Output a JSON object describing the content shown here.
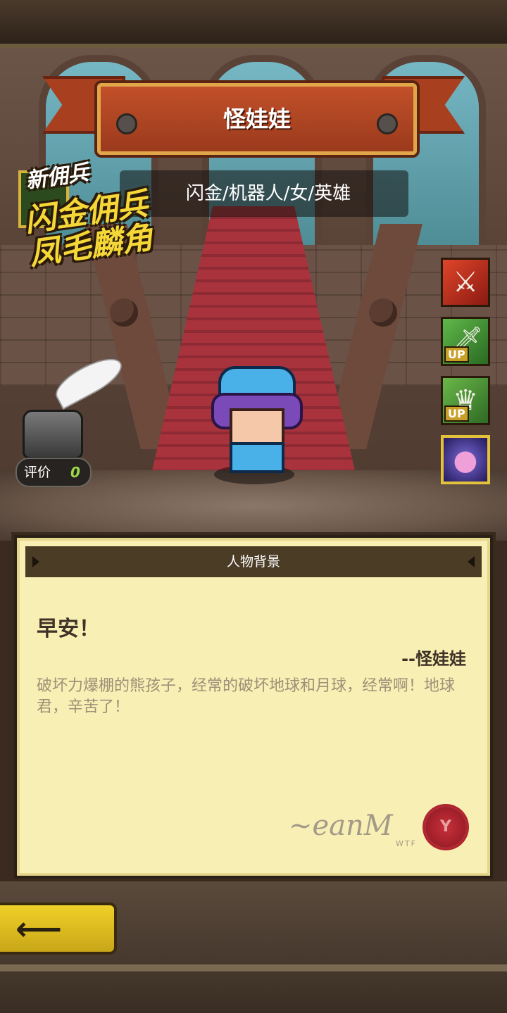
{
  "character": {
    "name": "怪娃娃",
    "subtitle": "闪金/机器人/女/英雄"
  },
  "promo": {
    "tag": "新佣兵",
    "line1": "闪金佣兵",
    "line2": "凤毛麟角"
  },
  "rating": {
    "label": "评价",
    "value": "0"
  },
  "skills": [
    {
      "icon": "slash-skill-icon"
    },
    {
      "icon": "weapon-up-icon",
      "badge": "UP"
    },
    {
      "icon": "crown-up-icon",
      "badge": "UP"
    },
    {
      "icon": "slime-icon"
    }
  ],
  "background_panel": {
    "title": "人物背景",
    "greeting": "早安！",
    "signoff": "--怪娃娃",
    "description": "破坏力爆棚的熊孩子，经常的破坏地球和月球，经常啊！地球君，辛苦了！"
  },
  "colors": {
    "banner": "#c2502a",
    "panel": "#f8efb4",
    "back_button": "#f0d028"
  }
}
